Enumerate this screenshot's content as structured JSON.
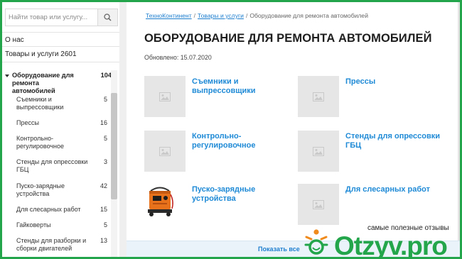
{
  "search": {
    "placeholder": "Найти товар или услугу..."
  },
  "sidebar": {
    "about": "О нас",
    "goods_services": "Товары и услуги 2601",
    "category": {
      "label": "Оборудование для ремонта автомобилей",
      "count": "104"
    },
    "subitems": [
      {
        "label": "Съемники и выпрессовщики",
        "count": "5"
      },
      {
        "label": "Прессы",
        "count": "16"
      },
      {
        "label": "Контрольно-регулировочное",
        "count": "5"
      },
      {
        "label": "Стенды для опрессовки ГБЦ",
        "count": "3"
      },
      {
        "label": "Пуско-зарядные устройства",
        "count": "42"
      },
      {
        "label": "Для слесарных работ",
        "count": "15"
      },
      {
        "label": "Гайковерты",
        "count": "5"
      },
      {
        "label": "Стенды для разборки и сборки двигателей",
        "count": "13"
      }
    ]
  },
  "breadcrumbs": {
    "items": [
      "ТехноКонтинент",
      "Товары и услуги",
      "Оборудование для ремонта автомобилей"
    ],
    "separator": "/"
  },
  "page": {
    "title": "ОБОРУДОВАНИЕ ДЛЯ РЕМОНТА АВТОМОБИЛЕЙ",
    "updated": "Обновлено: 15.07.2020"
  },
  "cards": [
    {
      "name": "Съемники и выпрессовщики",
      "image": "placeholder-image-icon"
    },
    {
      "name": "Прессы",
      "image": "placeholder-image-icon"
    },
    {
      "name": "Контрольно-регулировочное",
      "image": "placeholder-image-icon"
    },
    {
      "name": "Стенды для опрессовки ГБЦ",
      "image": "placeholder-image-icon"
    },
    {
      "name": "Пуско-зарядные устройства",
      "image": "charger-photo"
    },
    {
      "name": "Для слесарных работ",
      "image": "placeholder-image-icon"
    }
  ],
  "show_all": "Показать все",
  "watermark": {
    "caption": "самые полезные отзывы",
    "brand": "Otzyv.pro"
  },
  "colors": {
    "link": "#1f8ad6",
    "watermark_green": "#23a64b",
    "watermark_orange": "#f08a1c"
  }
}
